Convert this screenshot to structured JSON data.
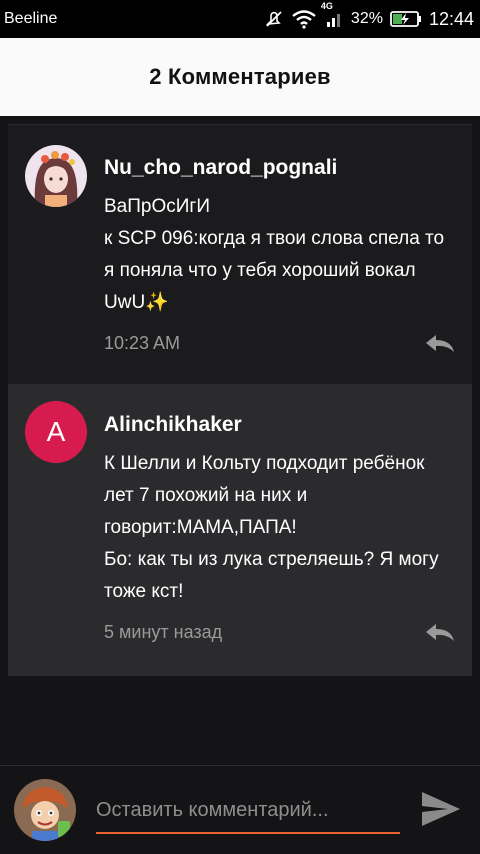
{
  "status_bar": {
    "carrier": "Beeline",
    "network": "4G",
    "battery": "32%",
    "time": "12:44"
  },
  "header": {
    "title": "2 Комментариев"
  },
  "comments": [
    {
      "author": "Nu_cho_narod_pognali",
      "avatar": "anime-girl-avatar",
      "text": "ВаПрОсИгИ\nк SCP 096:когда я твои слова спела то я поняла что у тебя хороший вокал UwU✨",
      "time": "10:23 AM"
    },
    {
      "author": "Alinchikhaker",
      "avatar_letter": "A",
      "avatar_color": "#d81b4e",
      "text": "К Шелли и Кольту подходит ребёнок лет 7 похожий на них и говорит:МАМА,ПАПА!\nБо: как ты из лука стреляешь? Я могу тоже кст!",
      "time": "5 минут назад"
    }
  ],
  "composer": {
    "placeholder": "Оставить комментарий...",
    "accent": "#e8622f"
  },
  "icons": {
    "reply": "reply-icon",
    "send": "send-icon"
  }
}
